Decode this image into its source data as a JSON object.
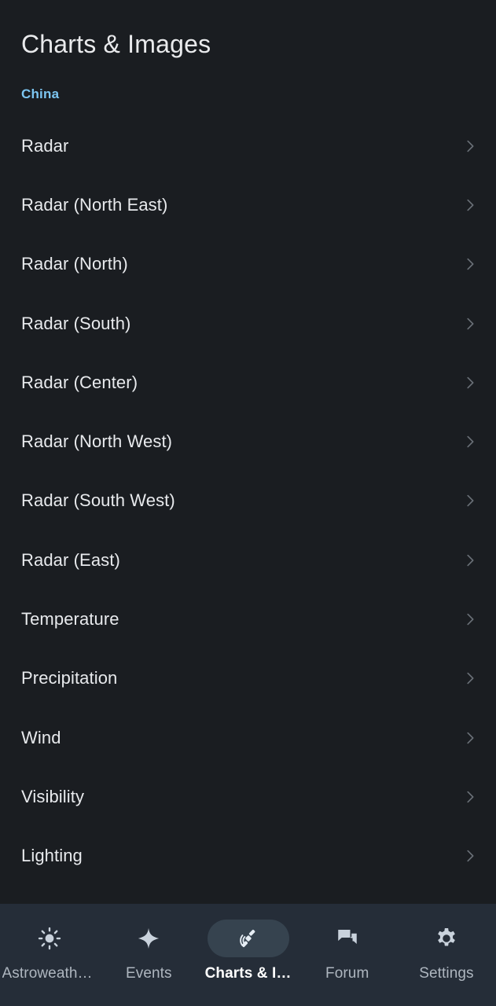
{
  "header": {
    "title": "Charts & Images"
  },
  "list": {
    "section_label": "China",
    "chevron_icon": "chevron-right-icon",
    "items": [
      {
        "label": "Radar"
      },
      {
        "label": "Radar (North East)"
      },
      {
        "label": "Radar (North)"
      },
      {
        "label": "Radar (South)"
      },
      {
        "label": "Radar (Center)"
      },
      {
        "label": "Radar (North West)"
      },
      {
        "label": "Radar (South West)"
      },
      {
        "label": "Radar (East)"
      },
      {
        "label": "Temperature"
      },
      {
        "label": "Precipitation"
      },
      {
        "label": "Wind"
      },
      {
        "label": "Visibility"
      },
      {
        "label": "Lighting"
      }
    ]
  },
  "bottom_nav": {
    "items": [
      {
        "label": "Astroweath…",
        "icon": "sun-icon",
        "active": false
      },
      {
        "label": "Events",
        "icon": "sparkle-star-icon",
        "active": false
      },
      {
        "label": "Charts & I…",
        "icon": "satellite-icon",
        "active": true
      },
      {
        "label": "Forum",
        "icon": "chat-bubbles-icon",
        "active": false
      },
      {
        "label": "Settings",
        "icon": "gear-icon",
        "active": false
      }
    ]
  },
  "colors": {
    "background": "#1a1d21",
    "nav_background": "#252d38",
    "accent_section": "#7cc5f0",
    "active_pill": "#36434f",
    "primary_text": "#e8eaed",
    "muted_text": "#aeb6bf"
  }
}
